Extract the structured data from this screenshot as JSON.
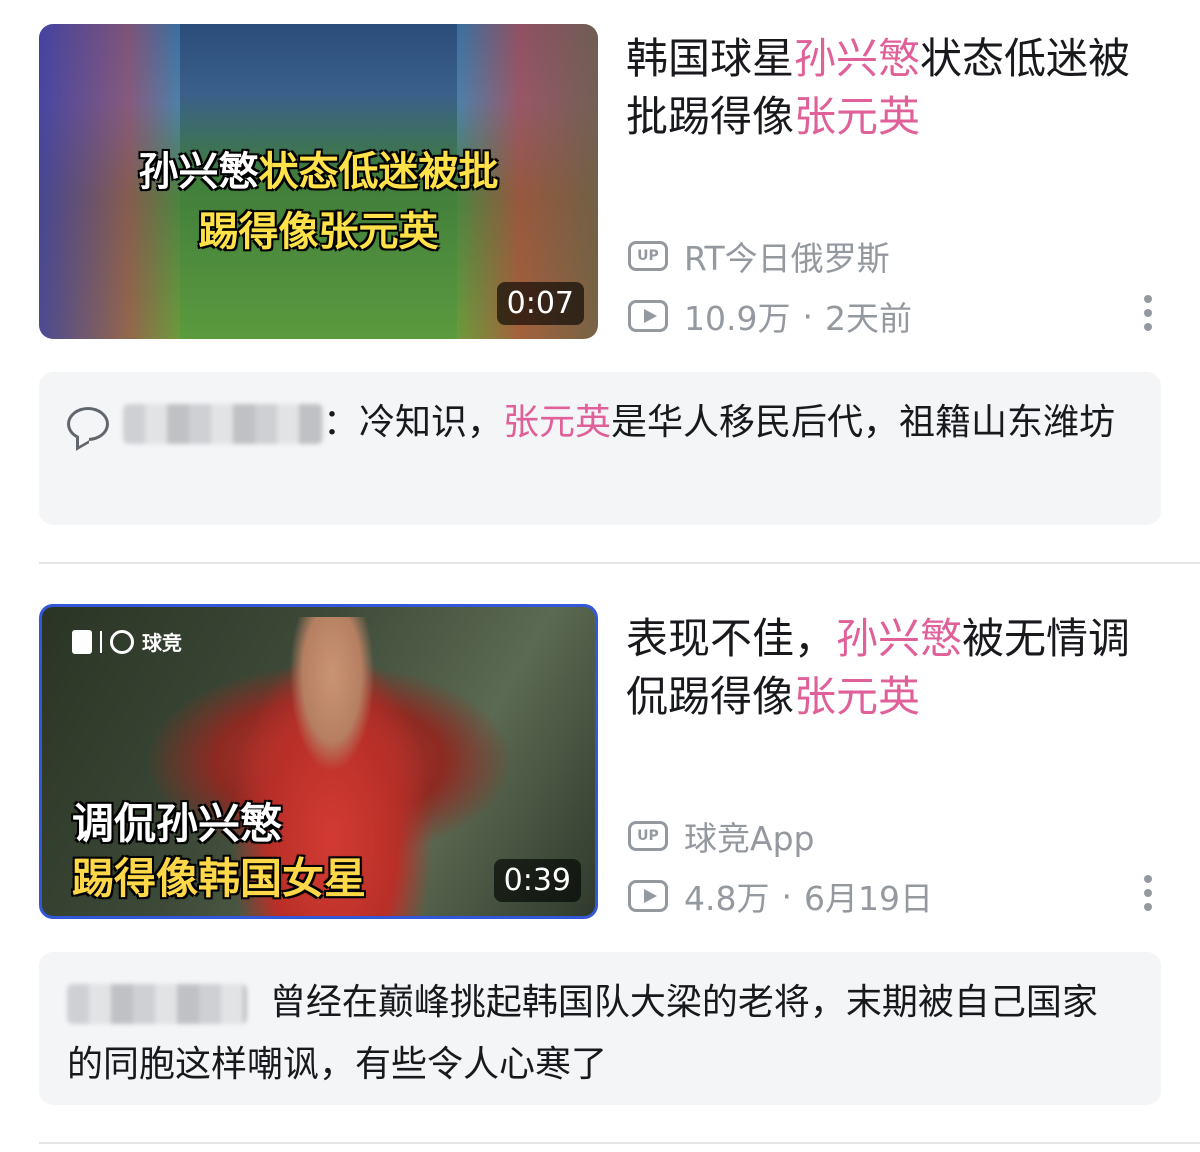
{
  "feed": [
    {
      "thumbnail": {
        "caption_line1_part1": "孙兴慜",
        "caption_line1_part2": "状态低迷被批",
        "caption_line2": "踢得像张元英",
        "duration": "0:07"
      },
      "title_segments": [
        {
          "text": "韩国球星",
          "highlight": false
        },
        {
          "text": "孙兴慜",
          "highlight": true
        },
        {
          "text": "状态低迷被批踢得像",
          "highlight": false
        },
        {
          "text": "张元英",
          "highlight": true
        }
      ],
      "uploader_icon": "UP",
      "uploader": "RT今日俄罗斯",
      "views": "10.9万",
      "date": "2天前",
      "comment": {
        "prefix": "：冷知识，",
        "highlight": "张元英",
        "text": "是华人移民后代，祖籍山东潍坊"
      }
    },
    {
      "thumbnail": {
        "brand": "球竞",
        "caption_line1": "调侃孙兴慜",
        "caption_line2": "踢得像韩国女星",
        "duration": "0:39"
      },
      "title_segments": [
        {
          "text": "表现不佳，",
          "highlight": false
        },
        {
          "text": "孙兴慜",
          "highlight": true
        },
        {
          "text": "被无情调侃踢得像",
          "highlight": false
        },
        {
          "text": "张元英",
          "highlight": true
        }
      ],
      "uploader_icon": "UP",
      "uploader": "球竞App",
      "views": "4.8万",
      "date": "6月19日",
      "comment": {
        "text": "曾经在巅峰挑起韩国队大梁的老将，末期被自己国家的同胞这样嘲讽，有些令人心寒了"
      }
    }
  ],
  "colors": {
    "highlight": "#e0609a",
    "meta_gray": "#9499a0",
    "comment_bg": "#f4f5f7"
  },
  "icons": [
    "up-badge-icon",
    "play-count-icon",
    "more-vertical-icon",
    "comment-bubble-icon"
  ]
}
